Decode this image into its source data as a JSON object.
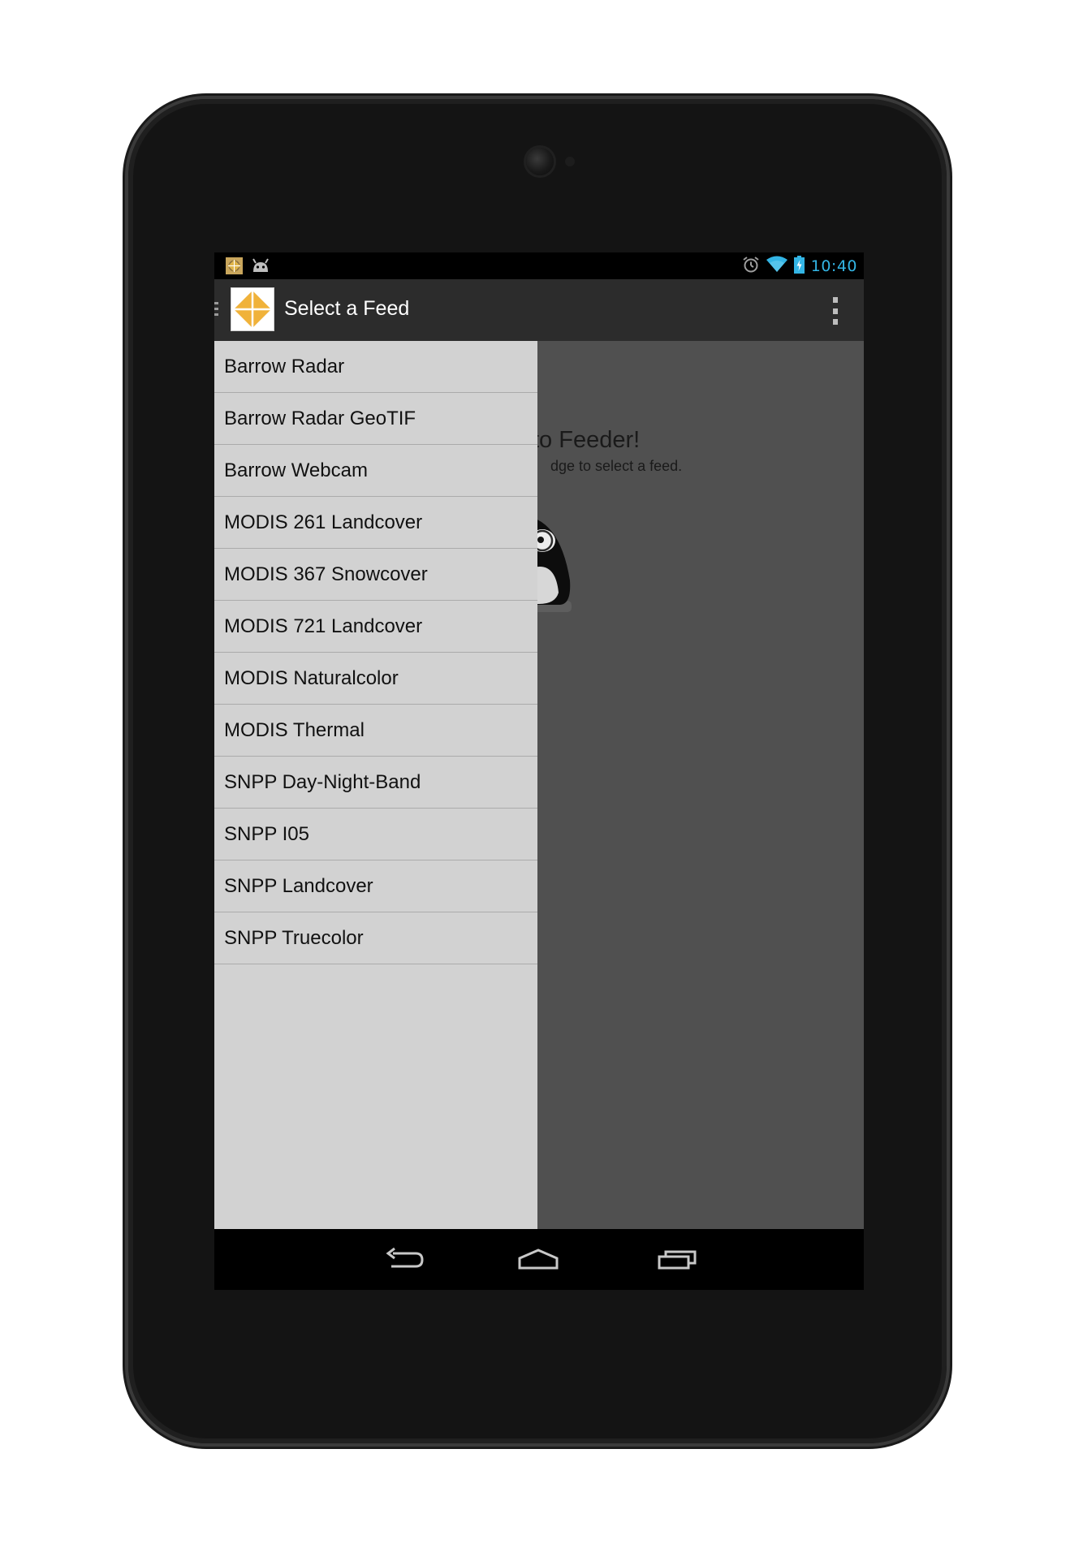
{
  "status_bar": {
    "time": "10:40",
    "left_icons": [
      "feeder-notification-icon",
      "android-debug-icon"
    ],
    "right_icons": [
      "alarm-icon",
      "wifi-icon",
      "battery-charging-icon"
    ],
    "time_color": "#33b5e5"
  },
  "action_bar": {
    "title": "Select a Feed",
    "logo_colors": [
      "#f0b23a",
      "#e8a020"
    ],
    "menu_icon": "overflow-menu-icon"
  },
  "content": {
    "welcome_text": "to Feeder!",
    "hint_text": "dge to select a feed."
  },
  "drawer": {
    "items": [
      {
        "label": "Barrow Radar"
      },
      {
        "label": "Barrow Radar GeoTIF"
      },
      {
        "label": "Barrow Webcam"
      },
      {
        "label": "MODIS 261 Landcover"
      },
      {
        "label": "MODIS 367 Snowcover"
      },
      {
        "label": "MODIS 721 Landcover"
      },
      {
        "label": "MODIS Naturalcolor"
      },
      {
        "label": "MODIS Thermal"
      },
      {
        "label": "SNPP Day-Night-Band"
      },
      {
        "label": "SNPP I05"
      },
      {
        "label": "SNPP Landcover"
      },
      {
        "label": "SNPP Truecolor"
      }
    ]
  },
  "nav_bar": {
    "buttons": [
      "back-icon",
      "home-icon",
      "recent-apps-icon"
    ]
  }
}
